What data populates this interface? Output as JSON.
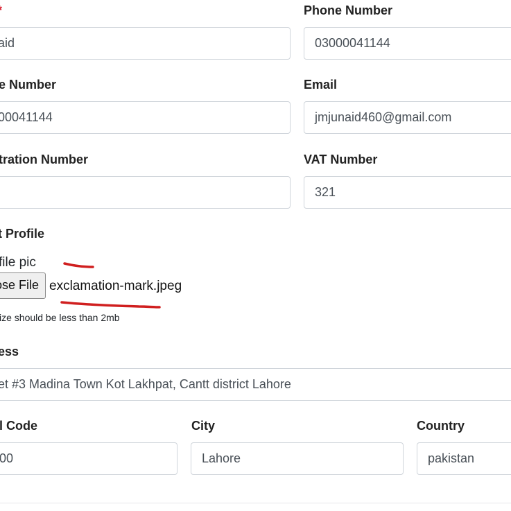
{
  "form": {
    "name_label_partial": "",
    "name_required_marker": "*",
    "name_value_partial": "aid",
    "phone_label": "Phone Number",
    "phone_value": "03000041144",
    "mobile_label_partial": "e Number",
    "mobile_value_partial": "00041144",
    "email_label": "Email",
    "email_value": "jmjunaid460@gmail.com",
    "registration_label_partial": "tration Number",
    "registration_value": "",
    "vat_label": "VAT Number",
    "vat_value": "321",
    "profile_section_partial": "t Profile",
    "profile_pic_label_partial": "file pic",
    "choose_file_label_partial": "ose File",
    "chosen_file_name": "exclamation-mark.jpeg",
    "file_size_hint_partial": "ize should be less than 2mb",
    "address_label_partial": "ess",
    "address_value_partial": "et #3 Madina Town Kot Lakhpat, Cantt district Lahore",
    "postal_label_partial": "l Code",
    "postal_value_partial": "00",
    "city_label": "City",
    "city_value": "Lahore",
    "country_label": "Country",
    "country_value": "pakistan"
  },
  "annotations": {
    "marker_color": "#d01f1f"
  }
}
